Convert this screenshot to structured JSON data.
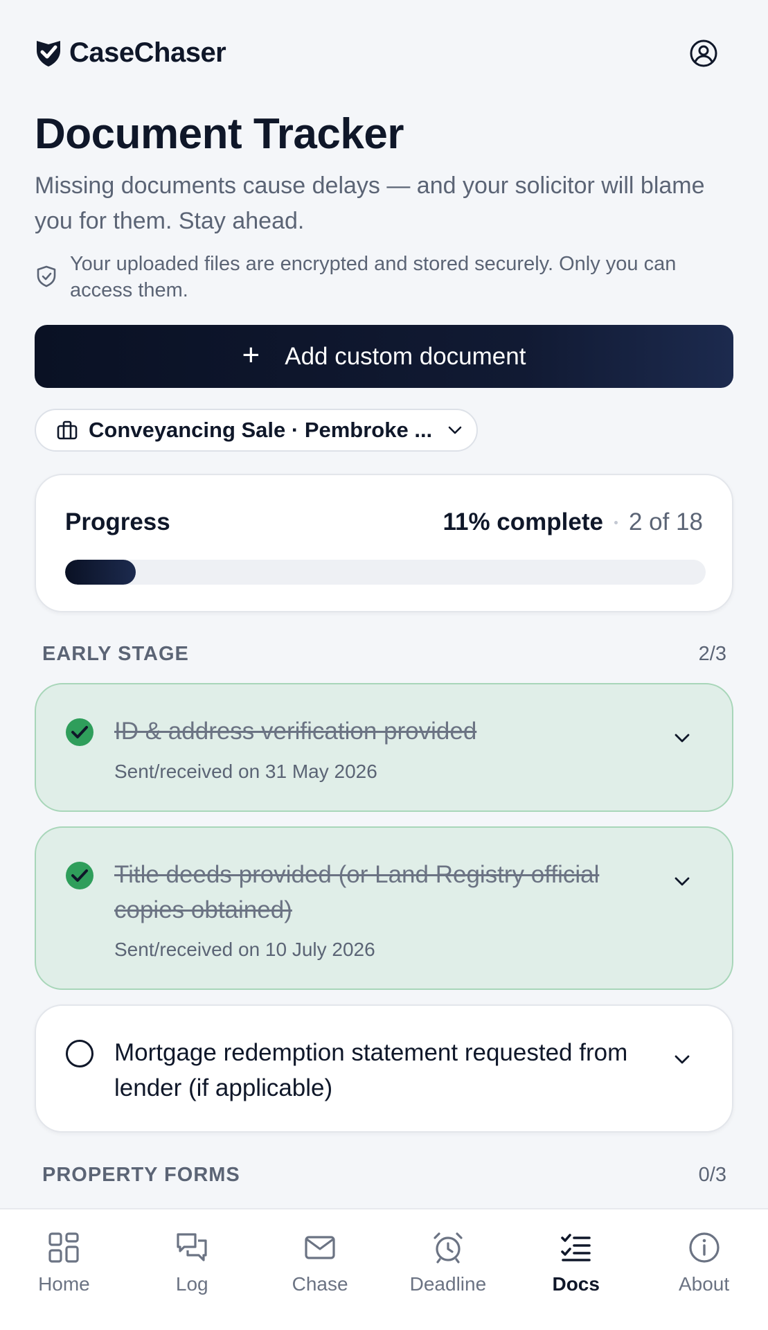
{
  "app": {
    "name": "CaseChaser"
  },
  "page": {
    "title": "Document Tracker",
    "subtitle": "Missing documents cause delays — and your solicitor will blame you for them. Stay ahead.",
    "security_note": "Your uploaded files are encrypted and stored securely. Only you can access them."
  },
  "actions": {
    "add_custom_document": "Add custom document"
  },
  "case_selector": {
    "selected": "Conveyancing Sale · Pembroke ..."
  },
  "progress": {
    "label": "Progress",
    "percent_text": "11% complete",
    "count_text": "2 of 18",
    "fraction": 0.11
  },
  "sections": [
    {
      "name": "EARLY STAGE",
      "count": "2/3",
      "items": [
        {
          "title": "ID & address verification provided",
          "status": "done",
          "sub": "Sent/received on 31 May 2026"
        },
        {
          "title": "Title deeds provided (or Land Registry official copies obtained)",
          "status": "done",
          "sub": "Sent/received on 10 July 2026"
        },
        {
          "title": "Mortgage redemption statement requested from lender (if applicable)",
          "status": "todo",
          "sub": ""
        }
      ]
    },
    {
      "name": "PROPERTY FORMS",
      "count": "0/3",
      "items": []
    }
  ],
  "nav": [
    {
      "label": "Home",
      "icon": "home-grid-icon",
      "active": false
    },
    {
      "label": "Log",
      "icon": "chat-icon",
      "active": false
    },
    {
      "label": "Chase",
      "icon": "mail-icon",
      "active": false
    },
    {
      "label": "Deadline",
      "icon": "alarm-clock-icon",
      "active": false
    },
    {
      "label": "Docs",
      "icon": "checklist-icon",
      "active": true
    },
    {
      "label": "About",
      "icon": "info-icon",
      "active": false
    }
  ],
  "colors": {
    "primary": "#0f1729",
    "success": "#2f9e5b",
    "done_bg": "#e0eee8",
    "muted_text": "#5b6475",
    "page_bg": "#f4f6f9"
  }
}
